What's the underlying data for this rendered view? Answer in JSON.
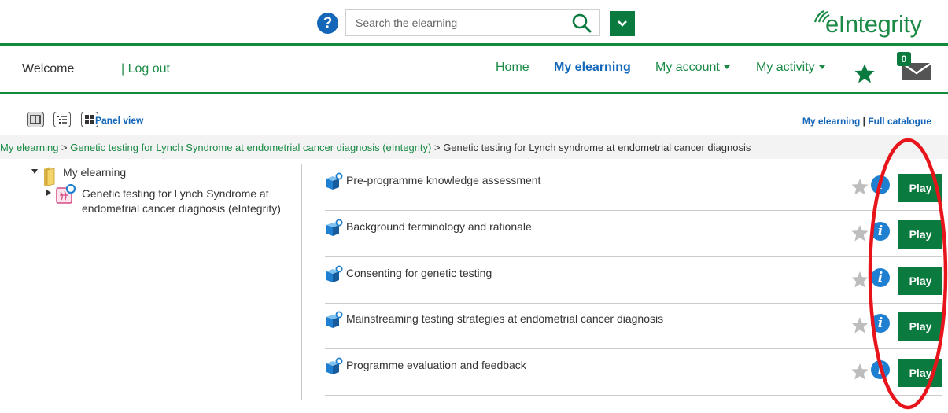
{
  "header": {
    "help_label": "?",
    "search_placeholder": "Search the elearning",
    "logo_text": "eIntegrity"
  },
  "nav": {
    "welcome": "Welcome",
    "logout": "| Log out",
    "home": "Home",
    "my_elearning": "My elearning",
    "my_account": "My account",
    "my_activity": "My activity",
    "mail_count": "0"
  },
  "toolbar": {
    "panel_view": "Panel view",
    "my_elearning_link": "My elearning",
    "separator": " | ",
    "full_catalogue": "Full catalogue"
  },
  "breadcrumb": {
    "items": [
      "My elearning",
      "Genetic testing for Lynch Syndrome at endometrial cancer diagnosis (eIntegrity)"
    ],
    "separator": " > ",
    "current": "Genetic testing for Lynch syndrome at endometrial cancer diagnosis"
  },
  "tree": {
    "root": "My elearning",
    "child": "Genetic testing for Lynch Syndrome at endometrial cancer diagnosis (eIntegrity)"
  },
  "sessions": [
    {
      "title": "Pre-programme knowledge assessment",
      "action": "Play"
    },
    {
      "title": "Background terminology and rationale",
      "action": "Play"
    },
    {
      "title": "Consenting for genetic testing",
      "action": "Play"
    },
    {
      "title": "Mainstreaming testing strategies at endometrial cancer diagnosis",
      "action": "Play"
    },
    {
      "title": "Programme evaluation and feedback",
      "action": "Play"
    }
  ],
  "colors": {
    "brand_green": "#0b7a3e",
    "link_green": "#1a8a45",
    "link_blue": "#1466b8",
    "annotation_red": "#e8141c"
  }
}
